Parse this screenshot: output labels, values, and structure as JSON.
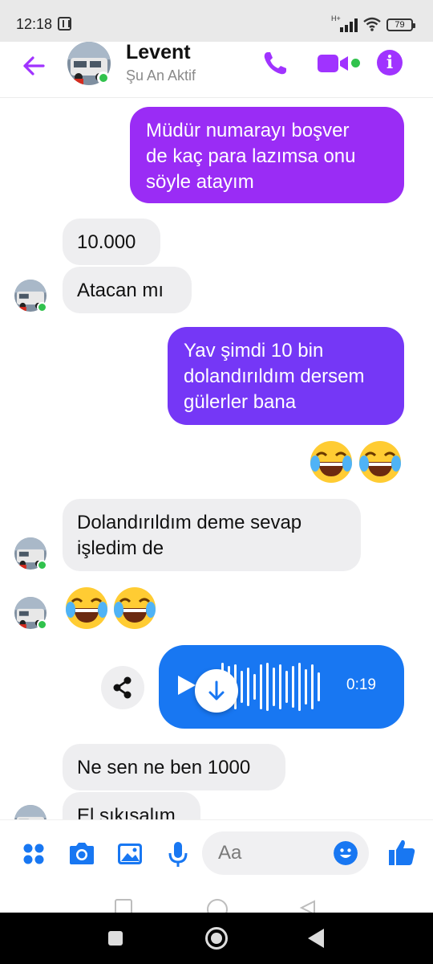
{
  "status_bar": {
    "time": "12:18",
    "network": "H+",
    "battery": "79"
  },
  "header": {
    "name": "Levent",
    "status": "Şu An Aktif"
  },
  "messages": {
    "m1": "Müdür numarayı boşver\nde kaç para lazımsa onu\nsöyle atayım",
    "m2": "10.000",
    "m3": "Atacan mı",
    "m4": "Yav şimdi 10 bin\ndolandırıldım dersem\ngülerler bana",
    "m5": "Dolandırıldım deme sevap\nişledim de",
    "m6": "Ne sen ne ben 1000",
    "m7": "El sıkışalım"
  },
  "voice": {
    "duration": "0:19"
  },
  "composer": {
    "placeholder": "Aa"
  },
  "colors": {
    "accent": "#a033ff",
    "blue": "#1877f2",
    "online": "#31c24d"
  }
}
